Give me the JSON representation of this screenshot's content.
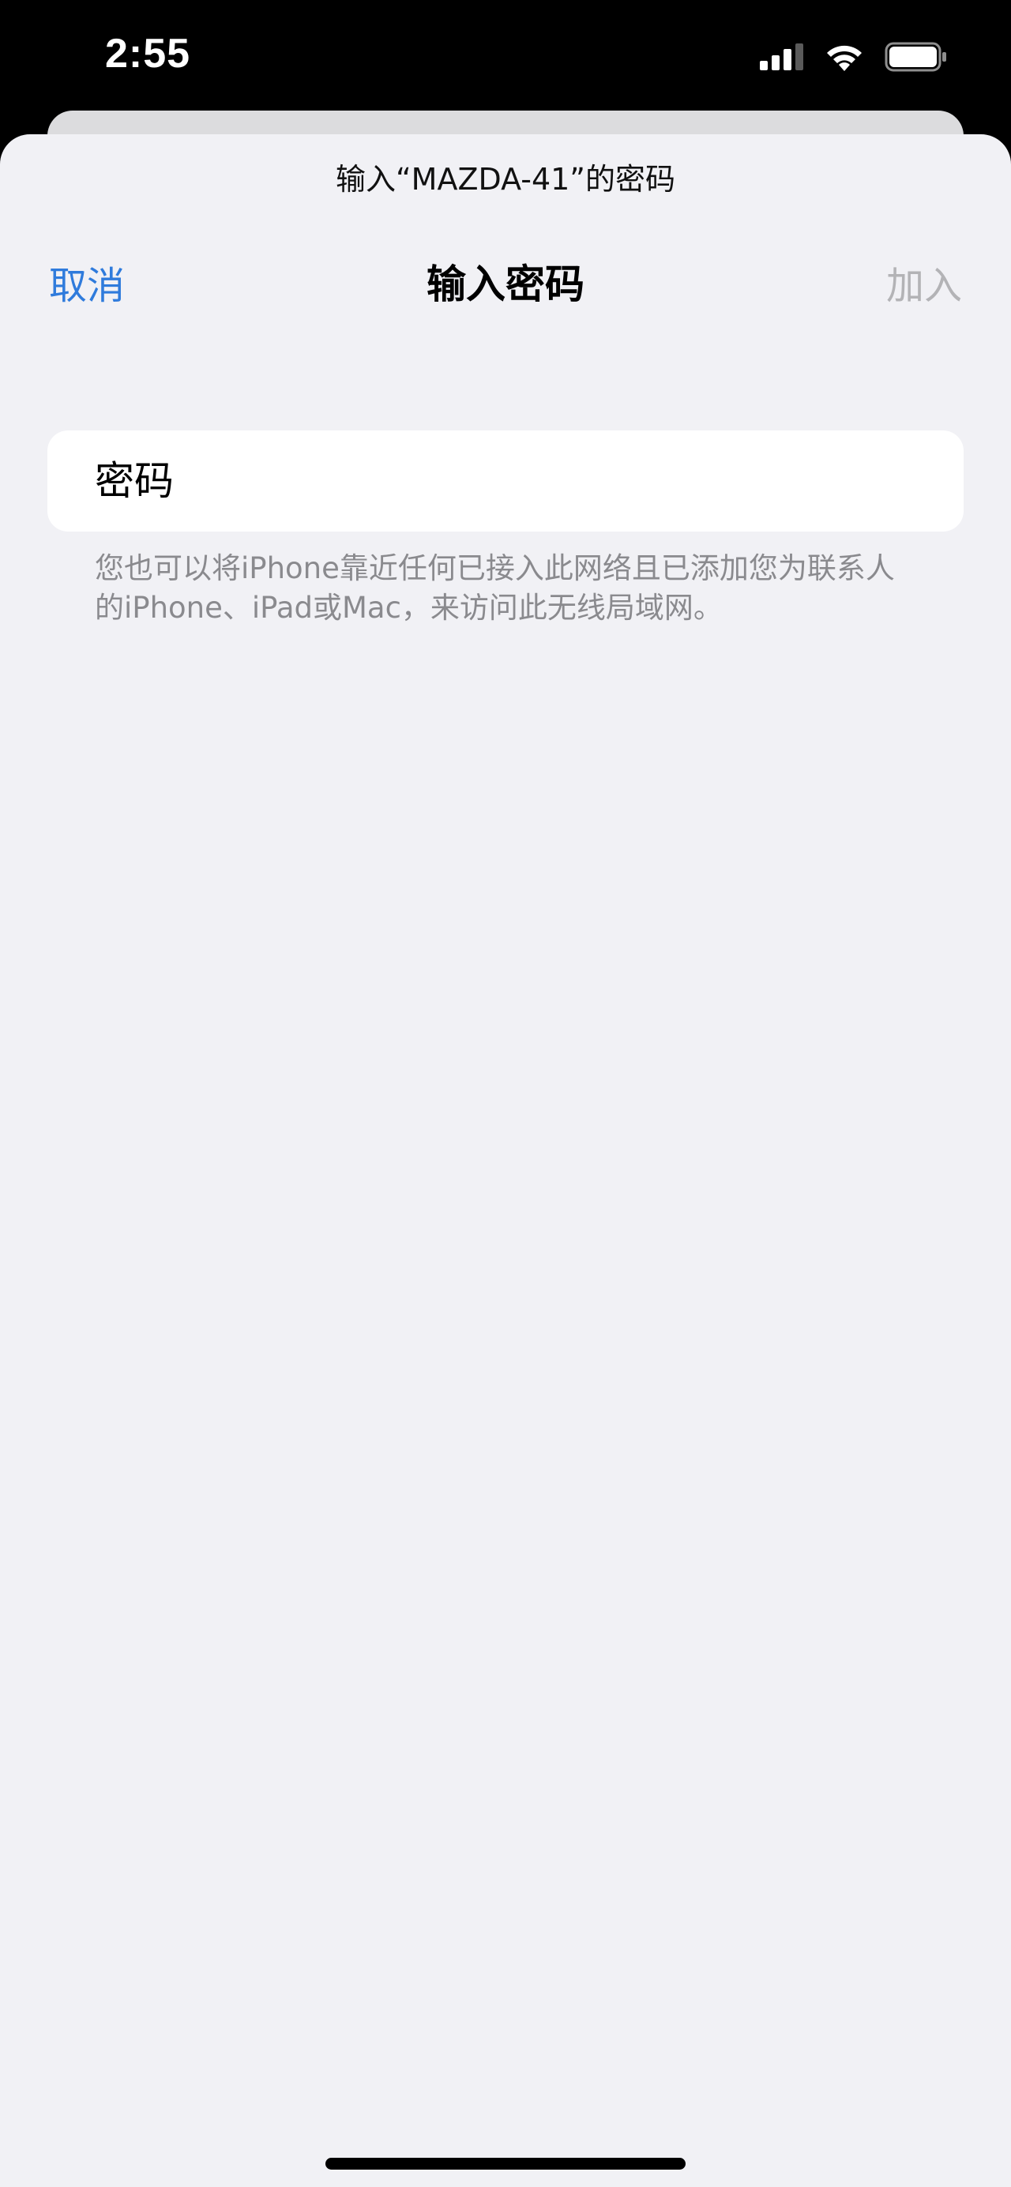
{
  "status_bar": {
    "time": "2:55",
    "icons": [
      "cellular-signal-icon",
      "wifi-icon",
      "battery-icon"
    ]
  },
  "sheet": {
    "prompt": "输入“MAZDA-41”的密码",
    "nav": {
      "cancel_label": "取消",
      "title": "输入密码",
      "join_label": "加入"
    },
    "password_field": {
      "placeholder": "密码",
      "value": ""
    },
    "footer_note": "您也可以将iPhone靠近任何已接入此网络且已添加您为联系人的iPhone、iPad或Mac，来访问此无线局域网。"
  },
  "colors": {
    "accent": "#2f7bdc",
    "disabled": "#b3b3b6",
    "sheet_background": "#f1f1f5",
    "footer_text": "#8a8a8e"
  }
}
